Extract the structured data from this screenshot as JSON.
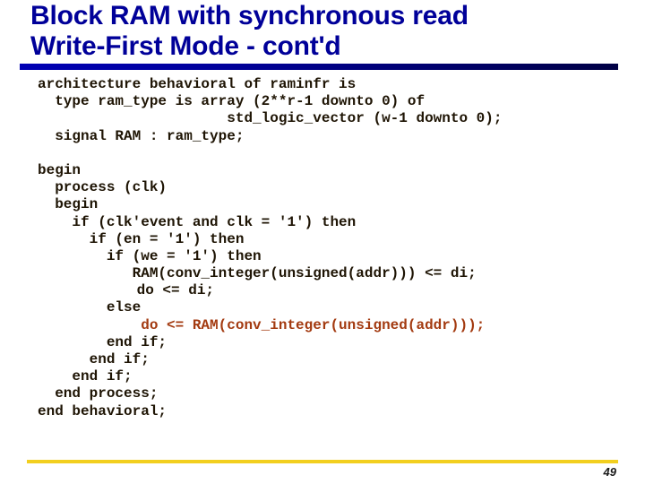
{
  "slide": {
    "title_line1": "Block RAM with synchronous read",
    "title_line2": "Write-First Mode - cont'd",
    "page_number": "49",
    "colors": {
      "title": "#000099",
      "code": "#1e1404",
      "highlight": "#a33a10",
      "title_rule_start": "#0000b4",
      "title_rule_end": "#000044",
      "footer_rule": "#f2cf1f"
    }
  },
  "code": {
    "language": "VHDL",
    "lines": [
      "architecture behavioral of raminfr is",
      "  type ram_type is array (2**r-1 downto 0) of",
      "                      std_logic_vector (w-1 downto 0);",
      "  signal RAM : ram_type;",
      "",
      "begin",
      "  process (clk)",
      "  begin",
      "    if (clk'event and clk = '1') then",
      "      if (en = '1') then",
      "        if (we = '1') then",
      "           RAM(conv_integer(unsigned(addr))) <= di;",
      "           do <= di;",
      "        else",
      "            do <= RAM(conv_integer(unsigned(addr)));",
      "        end if;",
      "      end if;",
      "    end if;",
      "  end process;",
      "end behavioral;"
    ],
    "highlighted_line_index": 14
  }
}
